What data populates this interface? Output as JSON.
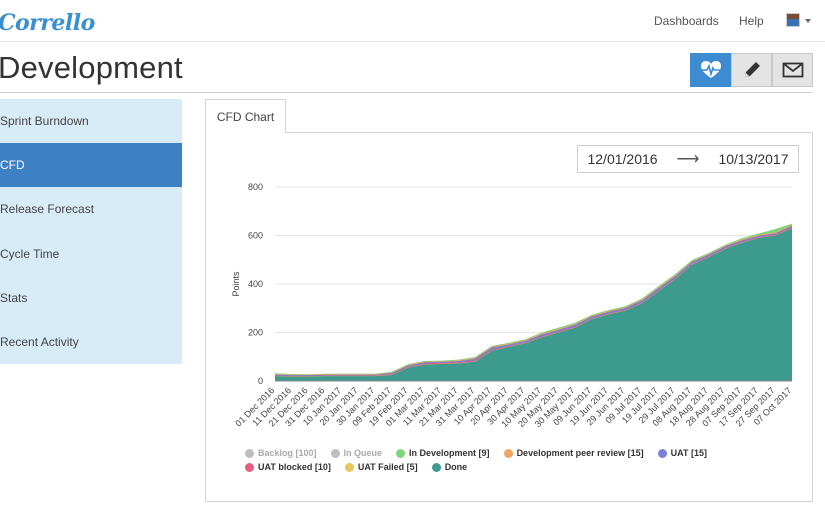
{
  "app": {
    "logo": "Corrello",
    "nav": {
      "dashboards": "Dashboards",
      "help": "Help"
    }
  },
  "page": {
    "title": "Development"
  },
  "toolbar": {
    "buttons": [
      {
        "icon": "heartbeat-icon",
        "active": true
      },
      {
        "icon": "pencil-icon",
        "active": false
      },
      {
        "icon": "envelope-icon",
        "active": false
      }
    ]
  },
  "sidebar": {
    "items": [
      {
        "label": "Sprint Burndown"
      },
      {
        "label": "CFD",
        "active": true
      },
      {
        "label": "Release Forecast"
      },
      {
        "label": "Cycle Time"
      },
      {
        "label": "Stats"
      },
      {
        "label": "Recent Activity"
      }
    ]
  },
  "tabs": [
    {
      "label": "CFD Chart"
    }
  ],
  "date_range": {
    "start": "12/01/2016",
    "arrow": "⟶",
    "end": "10/13/2017"
  },
  "chart_data": {
    "type": "area",
    "ylabel": "Points",
    "ylim": [
      0,
      800
    ],
    "yticks": [
      0,
      200,
      400,
      600,
      800
    ],
    "grid": true,
    "legend_position": "bottom",
    "x_tick_labels": [
      "01 Dec 2016",
      "11 Dec 2016",
      "21 Dec 2016",
      "31 Dec 2016",
      "10 Jan 2017",
      "20 Jan 2017",
      "30 Jan 2017",
      "09 Feb 2017",
      "19 Feb 2017",
      "01 Mar 2017",
      "11 Mar 2017",
      "21 Mar 2017",
      "31 Mar 2017",
      "10 Apr 2017",
      "20 Apr 2017",
      "30 Apr 2017",
      "10 May 2017",
      "20 May 2017",
      "30 May 2017",
      "09 Jun 2017",
      "19 Jun 2017",
      "29 Jun 2017",
      "09 Jul 2017",
      "19 Jul 2017",
      "29 Jul 2017",
      "08 Aug 2017",
      "18 Aug 2017",
      "28 Aug 2017",
      "07 Sep 2017",
      "17 Sep 2017",
      "27 Sep 2017",
      "07 Oct 2017"
    ],
    "done_values": [
      20,
      18,
      18,
      20,
      20,
      20,
      20,
      25,
      55,
      68,
      70,
      72,
      80,
      125,
      140,
      155,
      180,
      200,
      220,
      255,
      275,
      290,
      320,
      370,
      420,
      480,
      510,
      545,
      570,
      590,
      600,
      630
    ],
    "series": [
      {
        "name": "Backlog [100]",
        "color": "#bdbdbd",
        "visible": false
      },
      {
        "name": "In Queue",
        "color": "#bdbdbd",
        "visible": false
      },
      {
        "name": "In Development [9]",
        "color": "#7fd67a",
        "visible": true,
        "offsets": [
          4,
          3,
          2,
          2,
          2,
          2,
          2,
          3,
          3,
          3,
          3,
          3,
          4,
          3,
          4,
          4,
          4,
          5,
          5,
          4,
          4,
          4,
          4,
          5,
          5,
          5,
          4,
          4,
          5,
          5,
          14,
          4
        ]
      },
      {
        "name": "Development peer review [15]",
        "color": "#f0a461",
        "visible": true,
        "offsets": [
          2,
          2,
          2,
          2,
          2,
          2,
          2,
          2,
          3,
          2,
          2,
          3,
          3,
          4,
          3,
          3,
          4,
          4,
          3,
          3,
          4,
          3,
          4,
          4,
          4,
          3,
          3,
          3,
          4,
          4,
          4,
          5
        ]
      },
      {
        "name": "UAT [15]",
        "color": "#7b7fd8",
        "visible": true,
        "offsets": [
          3,
          3,
          3,
          3,
          3,
          3,
          3,
          4,
          5,
          5,
          4,
          5,
          6,
          8,
          6,
          6,
          8,
          7,
          8,
          7,
          6,
          7,
          8,
          9,
          8,
          7,
          7,
          6,
          6,
          5,
          5,
          6
        ]
      },
      {
        "name": "UAT blocked [10]",
        "color": "#e35d7f",
        "visible": true,
        "offsets": [
          2,
          2,
          2,
          2,
          2,
          2,
          2,
          3,
          3,
          4,
          4,
          4,
          5,
          4,
          3,
          3,
          3,
          3,
          3,
          3,
          3,
          3,
          3,
          3,
          3,
          3,
          3,
          3,
          3,
          3,
          3,
          3
        ]
      },
      {
        "name": "UAT Failed [5]",
        "color": "#e8c85a",
        "visible": true,
        "offsets": [
          1,
          1,
          1,
          1,
          1,
          1,
          1,
          1,
          1,
          1,
          1,
          1,
          1,
          1,
          1,
          1,
          1,
          1,
          1,
          1,
          1,
          1,
          1,
          1,
          1,
          1,
          1,
          1,
          1,
          1,
          1,
          1
        ]
      },
      {
        "name": "Done",
        "color": "#3d9a8e",
        "visible": true
      }
    ]
  }
}
